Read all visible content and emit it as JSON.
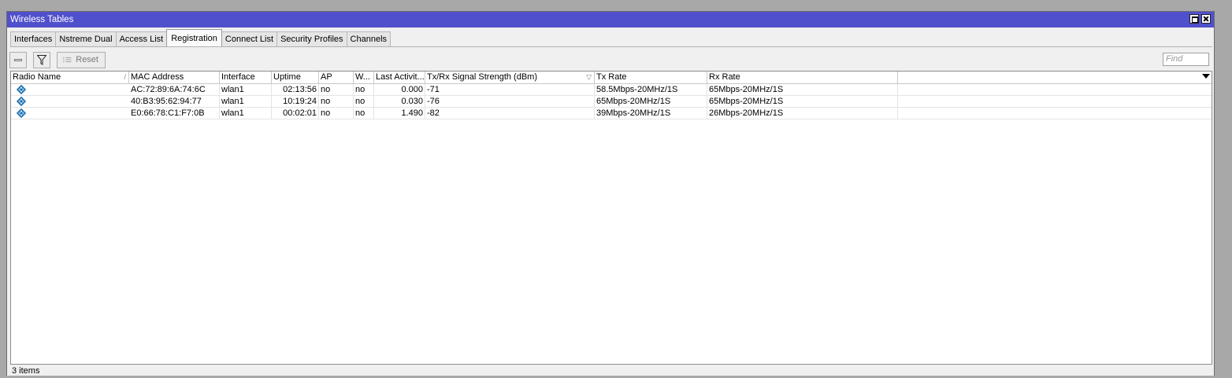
{
  "window": {
    "title": "Wireless Tables"
  },
  "tabs": [
    {
      "label": "Interfaces",
      "active": false
    },
    {
      "label": "Nstreme Dual",
      "active": false
    },
    {
      "label": "Access List",
      "active": false
    },
    {
      "label": "Registration",
      "active": true
    },
    {
      "label": "Connect List",
      "active": false
    },
    {
      "label": "Security Profiles",
      "active": false
    },
    {
      "label": "Channels",
      "active": false
    }
  ],
  "toolbar": {
    "reset_label": "Reset",
    "find_placeholder": "Find"
  },
  "table": {
    "columns": [
      "Radio Name",
      "MAC Address",
      "Interface",
      "Uptime",
      "AP",
      "W...",
      "Last Activit...",
      "Tx/Rx Signal Strength (dBm)",
      "Tx Rate",
      "Rx Rate"
    ],
    "rows": [
      {
        "radio_name": "",
        "mac": "AC:72:89:6A:74:6C",
        "interface": "wlan1",
        "uptime": "02:13:56",
        "ap": "no",
        "w": "no",
        "last_activity": "0.000",
        "signal": "-71",
        "tx_rate": "58.5Mbps-20MHz/1S",
        "rx_rate": "65Mbps-20MHz/1S"
      },
      {
        "radio_name": "",
        "mac": "40:B3:95:62:94:77",
        "interface": "wlan1",
        "uptime": "10:19:24",
        "ap": "no",
        "w": "no",
        "last_activity": "0.030",
        "signal": "-76",
        "tx_rate": "65Mbps-20MHz/1S",
        "rx_rate": "65Mbps-20MHz/1S"
      },
      {
        "radio_name": "",
        "mac": "E0:66:78:C1:F7:0B",
        "interface": "wlan1",
        "uptime": "00:02:01",
        "ap": "no",
        "w": "no",
        "last_activity": "1.490",
        "signal": "-82",
        "tx_rate": "39Mbps-20MHz/1S",
        "rx_rate": "26Mbps-20MHz/1S"
      }
    ]
  },
  "status": {
    "count_text": "3 items"
  },
  "colors": {
    "titlebar": "#5050cc",
    "icon": "#1a6fb0"
  }
}
